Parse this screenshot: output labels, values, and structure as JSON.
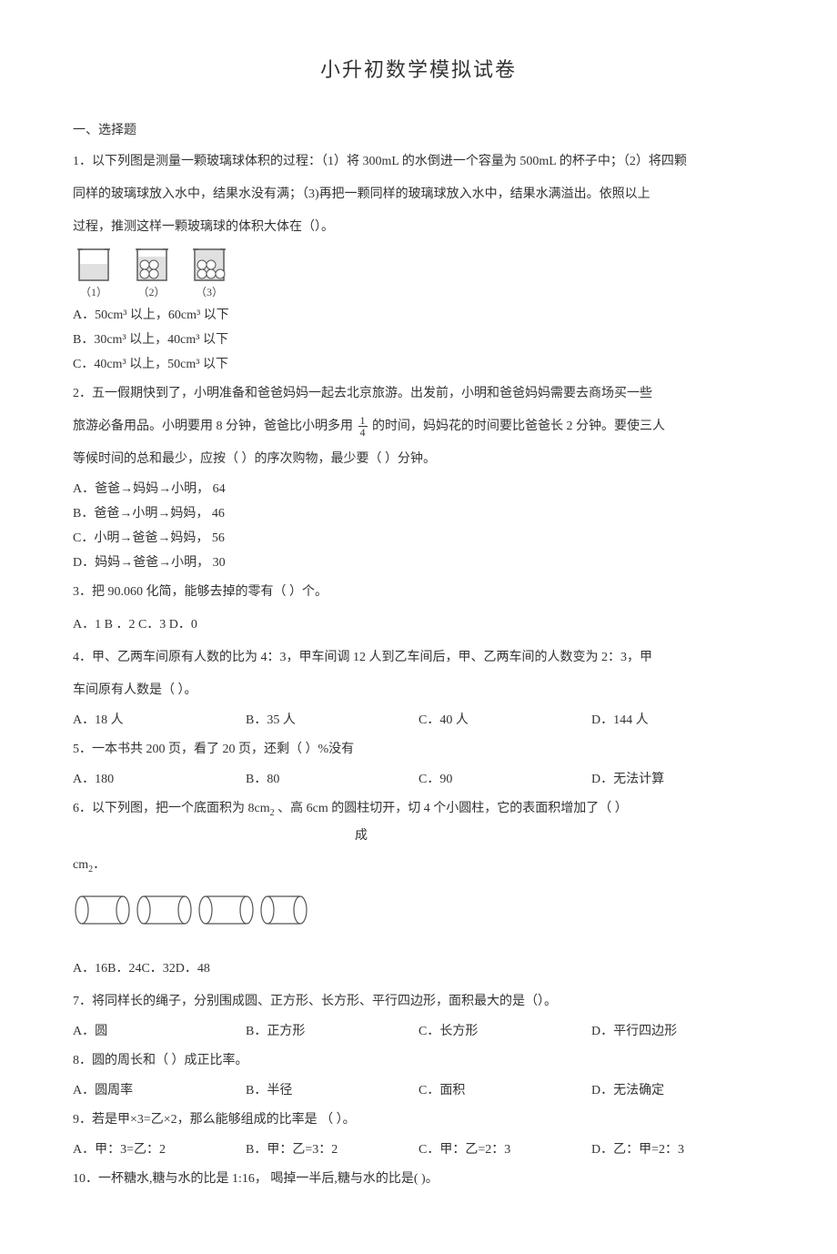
{
  "title": "小升初数学模拟试卷",
  "section1": "一、选择题",
  "q1": {
    "stem1": "1．以下列图是测量一颗玻璃球体积的过程：（1）将 300mL 的水倒进一个容量为 500mL 的杯子中；（2）将四颗",
    "stem2": "同样的玻璃球放入水中，结果水没有满；（3)再把一颗同样的玻璃球放入水中，结果水满溢出。依照以上",
    "stem3": "过程，推测这样一颗玻璃球的体积大体在（）。",
    "cap1": "（1）",
    "cap2": "（2）",
    "cap3": "（3）",
    "A": "A．50cm³ 以上，60cm³    以下",
    "B": "B．30cm³ 以上，40cm³    以下",
    "C": "C．40cm³    以上，50cm³    以下"
  },
  "q2": {
    "stem1": "2．五一假期快到了，小明准备和爸爸妈妈一起去北京旅游。出发前，小明和爸爸妈妈需要去商场买一些",
    "pre": "旅游必备用品。小明要用    8 分钟，爸爸比小明多用 ",
    "frac_num": "1",
    "frac_den": "4",
    "post": " 的时间，妈妈花的时间要比爸爸长    2 分钟。要使三人",
    "stem3": "等候时间的总和最少，应按（        ）的序次购物，最少要（        ）分钟。",
    "A": "A．爸爸→妈妈→小明，    64",
    "B": "B．爸爸→小明→妈妈，    46",
    "C": "C．小明→爸爸→妈妈，    56",
    "D": "D．妈妈→爸爸→小明，    30"
  },
  "q3": {
    "stem": "3．把  90.060  化简，能够去掉的零有（        ）个。",
    "opts": "A．1    B ．2    C．3       D．0"
  },
  "q4": {
    "stem": "4．甲、乙两车间原有人数的比为    4：3，甲车间调  12 人到乙车间后，甲、乙两车间的人数变为    2：3，甲",
    "stem2": "车间原有人数是（        ）。",
    "A": "A．18 人",
    "B": "B．35 人",
    "C": "C．40 人",
    "D": "D．144 人"
  },
  "q5": {
    "stem": "5．一本书共  200 页，看了 20 页，还剩（        ）%没有",
    "A": "A．180",
    "B": "B．80",
    "C": "C．90",
    "D": "D．无法计算"
  },
  "q6": {
    "pre": "6．以下列图，把一个底面积为    8cm",
    "mid": "、高 6cm 的圆柱切开，切    4 个小圆柱，它的表面积增加了（        ）",
    "cheng": "成",
    "unit": "cm",
    "opts": "A．16B．24C．32D．48"
  },
  "q7": {
    "stem": "7．将同样长的绳子，分别围成圆、正方形、长方形、平行四边形，面积最大的是（）。",
    "A": "A．圆",
    "B": "B．正方形",
    "C": "C．长方形",
    "D": "D．平行四边形"
  },
  "q8": {
    "stem": "8．圆的周长和（        ）成正比率。",
    "A": "A．圆周率",
    "B": "B．半径",
    "C": "C．面积",
    "D": "D．无法确定"
  },
  "q9": {
    "stem": "9．若是甲×3=乙×2，那么能够组成的比率是    （        ）。",
    "A": "A．甲：3=乙：2",
    "B": "B．甲：乙­=3：2",
    "C": "C．甲：乙=2：3",
    "D": "D．乙：甲=2：3"
  },
  "q10": {
    "stem": "10．一杯糖水,糖与水的比是 1:16，    喝掉一半后,糖与水的比是(            )。"
  }
}
